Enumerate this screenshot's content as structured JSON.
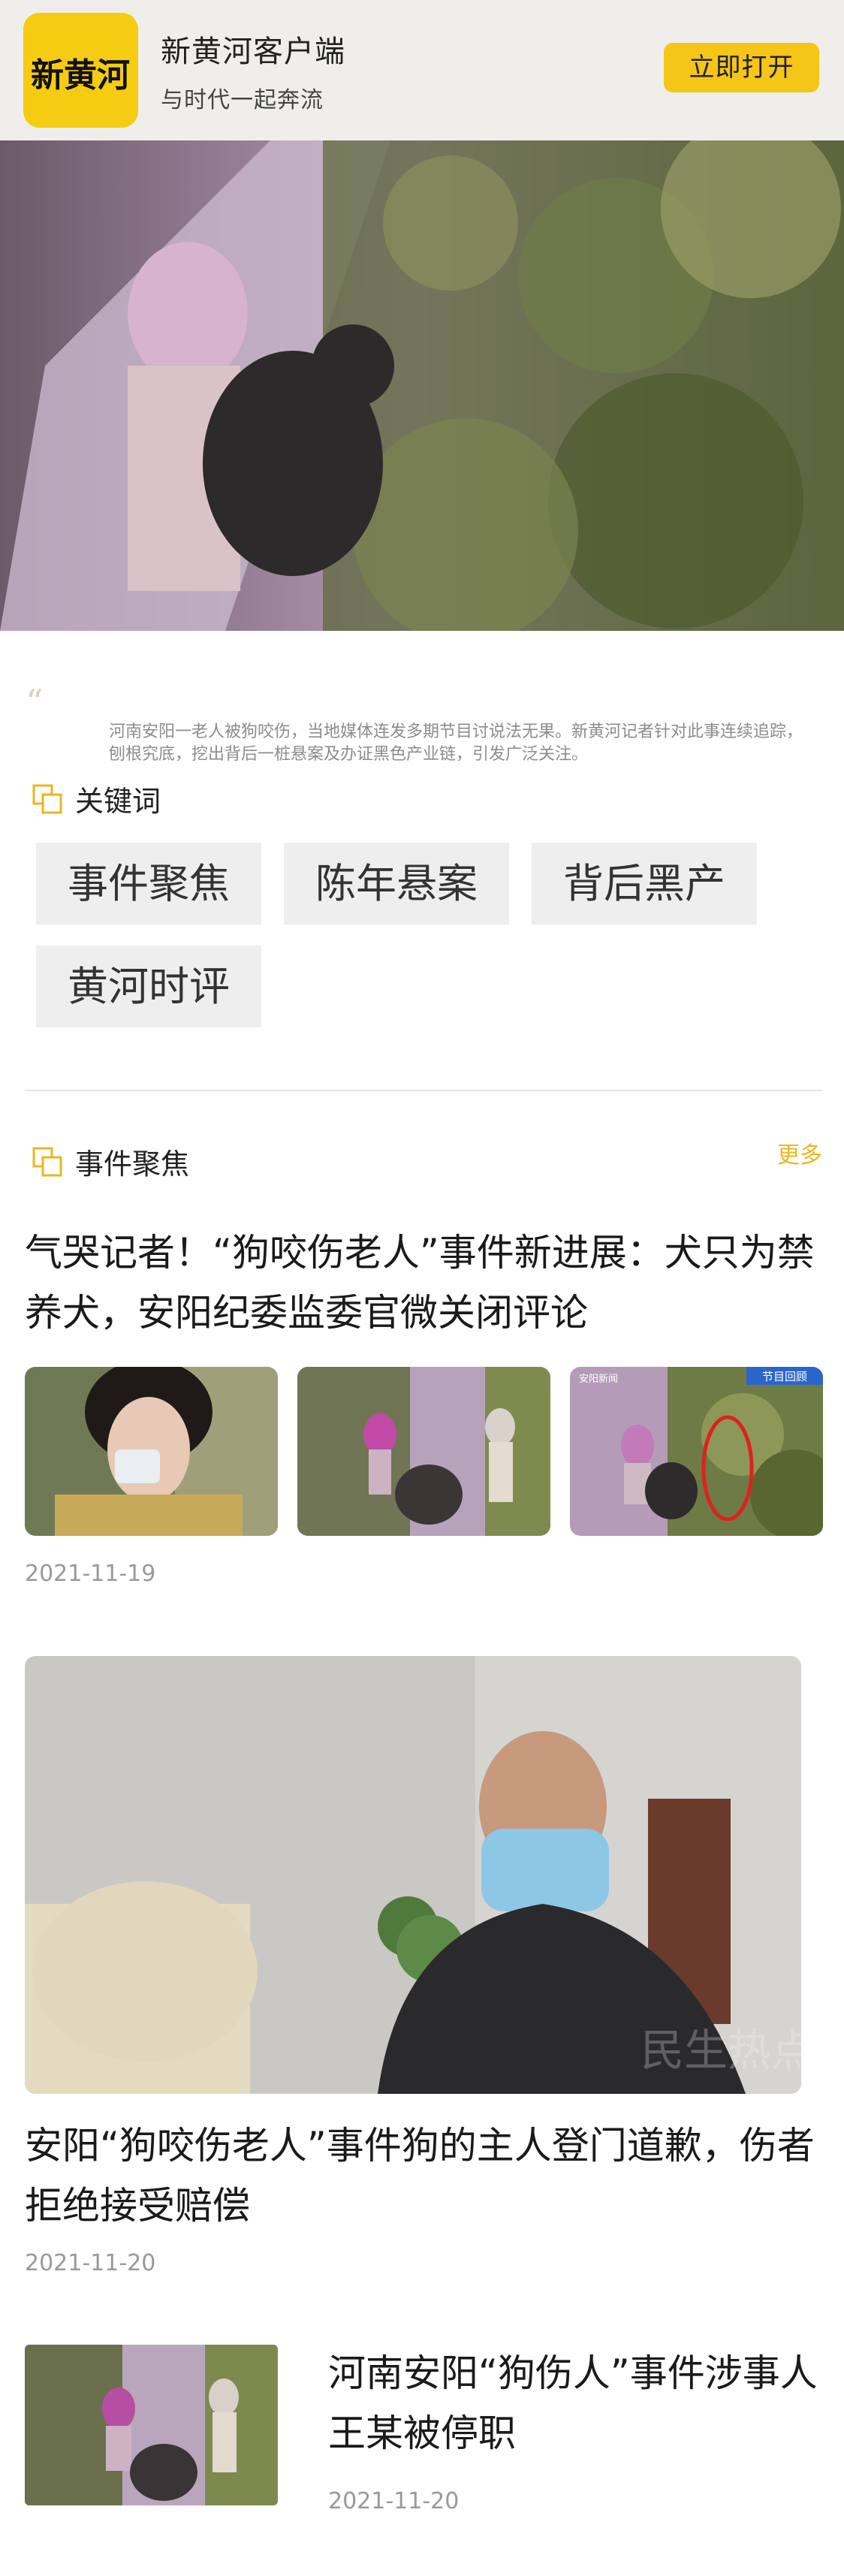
{
  "banner": {
    "logo_text": "新黄河",
    "app_name": "新黄河客户端",
    "slogan": "与时代一起奔流",
    "open_button": "立即打开"
  },
  "summary": {
    "text": "河南安阳一老人被狗咬伤，当地媒体连发多期节目讨说法无果。新黄河记者针对此事连续追踪，刨根究底，挖出背后一桩悬案及办证黑色产业链，引发广泛关注。"
  },
  "keywords": {
    "heading": "关键词",
    "tags": [
      "事件聚焦",
      "陈年悬案",
      "背后黑产",
      "黄河时评"
    ]
  },
  "focus_section": {
    "heading": "事件聚焦",
    "more": "更多"
  },
  "articles": [
    {
      "title": "气哭记者！“狗咬伤老人”事件新进展：犬只为禁养犬，安阳纪委监委官微关闭评论",
      "date": "2021-11-19",
      "thumb_badges": [
        "安阳新闻",
        "节目回顾"
      ]
    },
    {
      "title": "安阳“狗咬伤老人”事件狗的主人登门道歉，伤者拒绝接受赔偿",
      "date": "2021-11-20",
      "watermark": "民生热点"
    },
    {
      "title": "河南安阳“狗伤人”事件涉事人王某被停职",
      "date": "2021-11-20"
    }
  ],
  "colors": {
    "accent_yellow": "#f5c518",
    "banner_bg": "#f0eeeb",
    "more_link": "#e7b821",
    "tag_bg": "#eeeeee"
  }
}
